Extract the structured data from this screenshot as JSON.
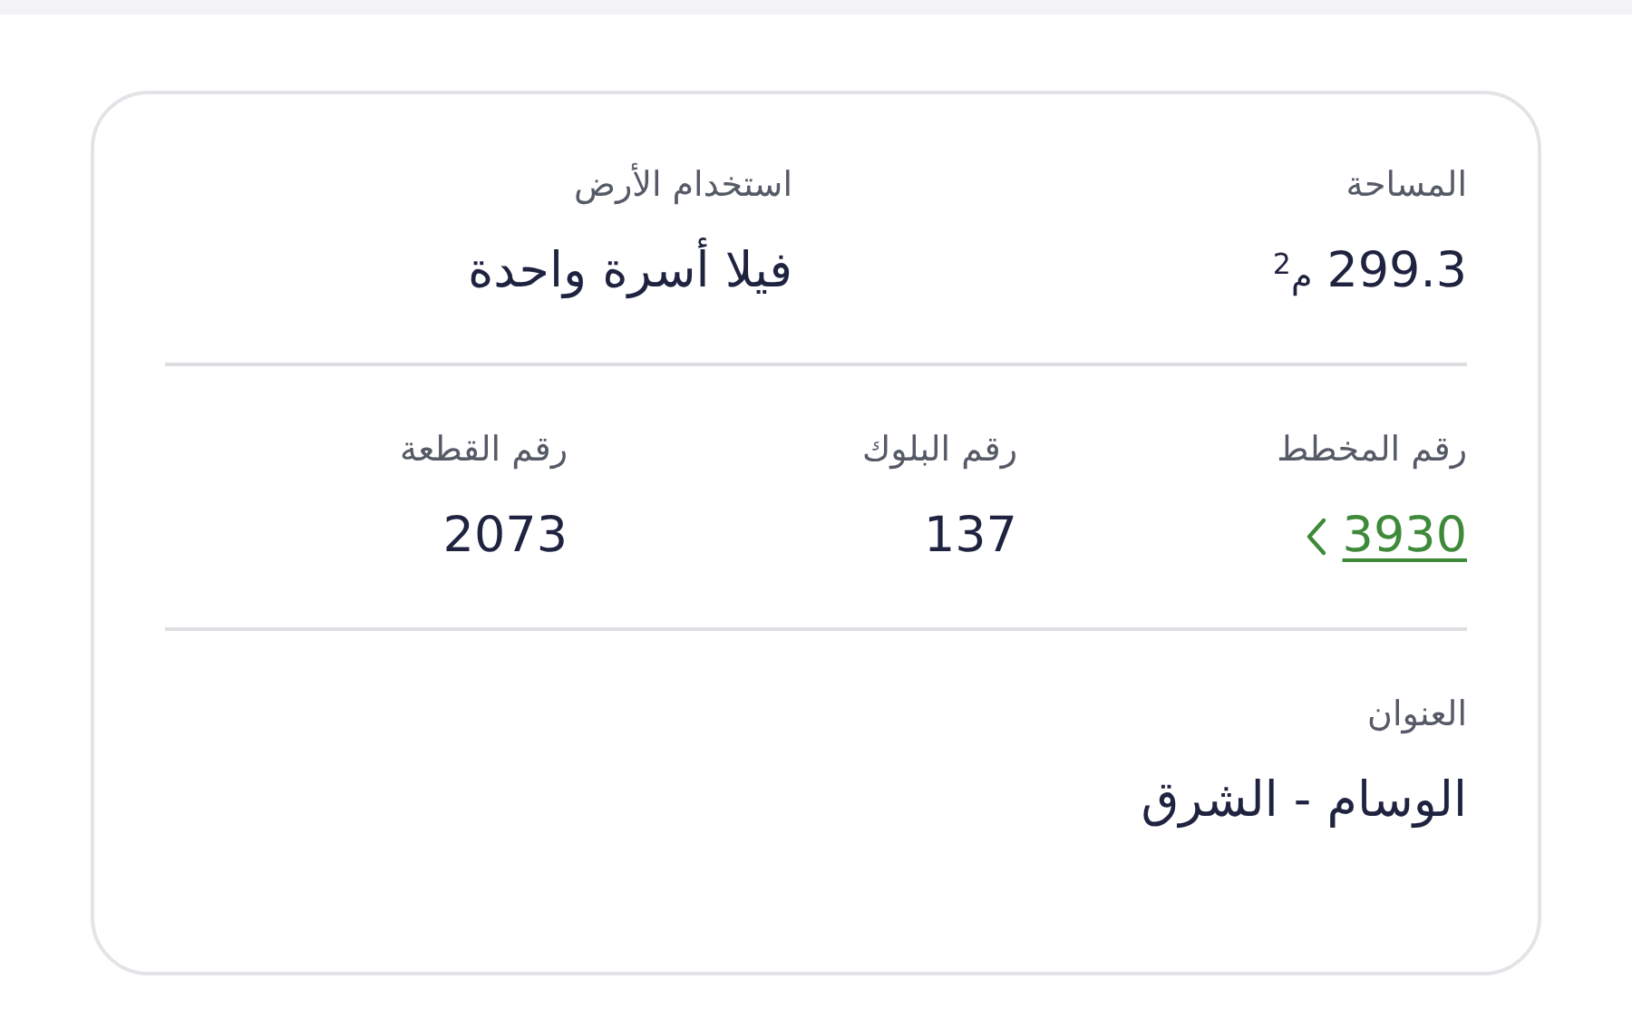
{
  "top_row": [
    {
      "label": "المساحة",
      "value": "299.3",
      "unit": "م$^{2}$"
    },
    {
      "label": "استخدام الأرض",
      "value": "فيلا أسرة واحدة"
    }
  ],
  "middle_row": [
    {
      "label": "رقم المخطط",
      "value": "3930",
      "kind": "link"
    },
    {
      "label": "رقم البلوك",
      "value": "137",
      "kind": "text"
    },
    {
      "label": "رقم القطعة",
      "value": "2073",
      "kind": "text"
    }
  ],
  "address": {
    "label": "العنوان",
    "value": "الوسام - الشرق"
  }
}
